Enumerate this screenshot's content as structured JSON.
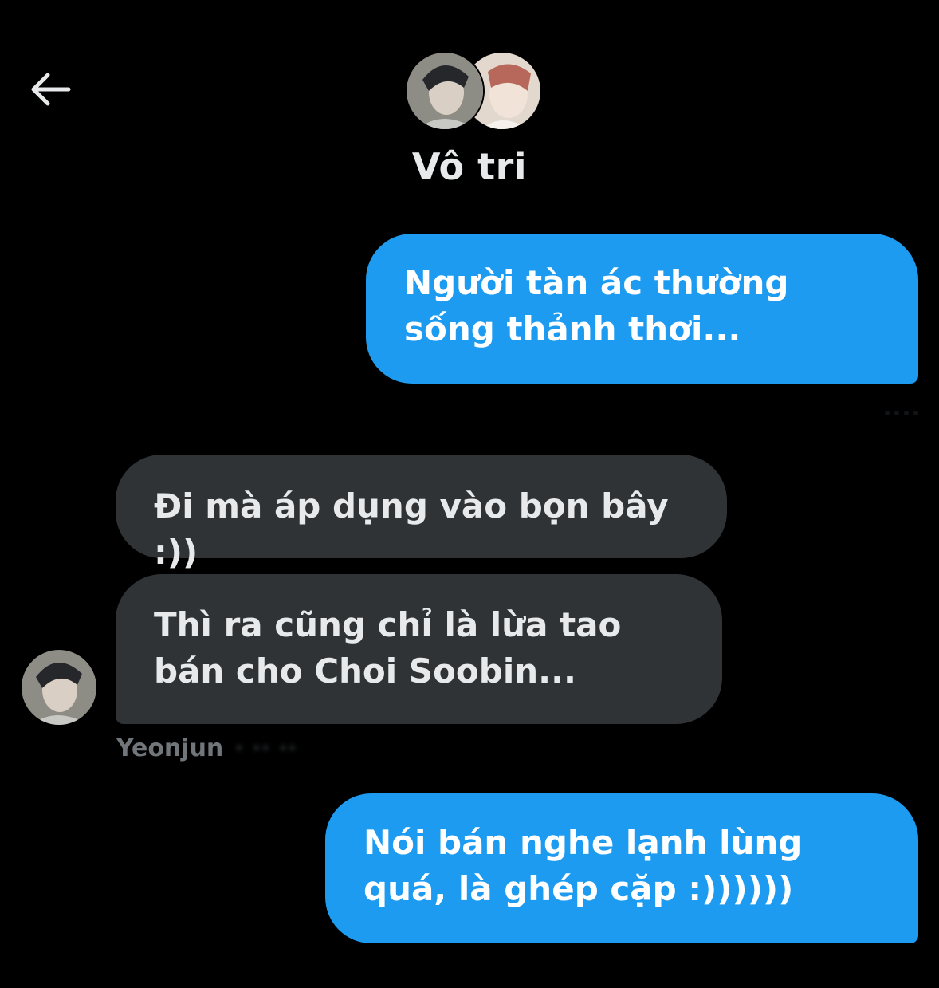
{
  "header": {
    "back_icon": "arrow-left-icon",
    "title": "Vô tri",
    "avatars": [
      {
        "icon": "group-member-avatar",
        "colors": [
          "#6f6f6a",
          "#d8d6cf",
          "#2a2c30"
        ]
      },
      {
        "icon": "group-member-avatar",
        "colors": [
          "#cfc3b8",
          "#b7685a",
          "#efe9e3"
        ]
      }
    ]
  },
  "messages": [
    {
      "direction": "sent",
      "text": "Người tàn ác thường sống thảnh thơi..."
    },
    {
      "direction": "received",
      "text": "Đi mà áp dụng vào bọn bây :))"
    },
    {
      "direction": "received",
      "text": "Thì ra cũng chỉ là lừa tao bán cho Choi Soobin..."
    },
    {
      "direction": "sent",
      "text": "Nói bán nghe lạnh lùng quá, là ghép cặp :))))))"
    }
  ],
  "sender": {
    "name": "Yeonjun",
    "avatar_icon": "sender-avatar"
  },
  "colors": {
    "background": "#000000",
    "sent_bubble": "#1d9bf0",
    "received_bubble": "#2f3336",
    "title_text": "#e7e9ea",
    "meta_text": "#71767b"
  }
}
